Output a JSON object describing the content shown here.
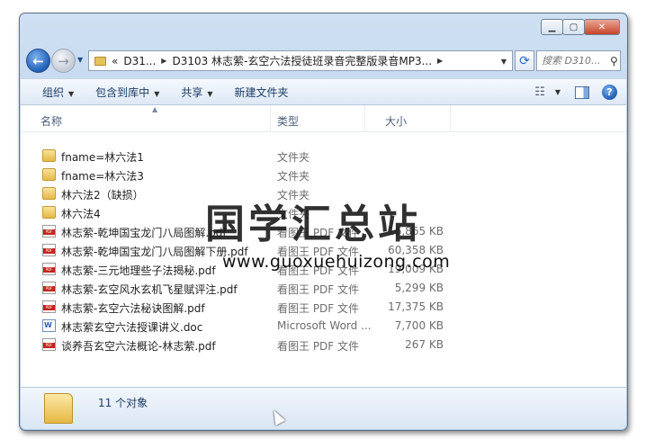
{
  "address": {
    "prefix": "«",
    "part1": "D31...",
    "part2": "D3103 林志萦-玄空六法授徒班录音完整版录音MP3..."
  },
  "search": {
    "placeholder": "搜索 D310..."
  },
  "toolbar": {
    "organize": "组织",
    "include_library": "包含到库中",
    "share": "共享",
    "new_folder": "新建文件夹"
  },
  "columns": {
    "name": "名称",
    "type": "类型",
    "size": "大小"
  },
  "files": [
    {
      "name": "fname=林六法1",
      "type": "文件夹",
      "size": "",
      "icon": "folder-icon"
    },
    {
      "name": "fname=林六法3",
      "type": "文件夹",
      "size": "",
      "icon": "folder-icon"
    },
    {
      "name": "林六法2（缺损）",
      "type": "文件夹",
      "size": "",
      "icon": "folder-icon"
    },
    {
      "name": "林六法4",
      "type": "文件夹",
      "size": "",
      "icon": "folder-icon"
    },
    {
      "name": "林志萦-乾坤国宝龙门八局图解.pdf",
      "type": "看图王 PDF 文件",
      "size": "16,865 KB",
      "icon": "pdf-file-icon"
    },
    {
      "name": "林志萦-乾坤国宝龙门八局图解下册.pdf",
      "type": "看图王 PDF 文件",
      "size": "60,358 KB",
      "icon": "pdf-file-icon"
    },
    {
      "name": "林志萦-三元地理些子法揭秘.pdf",
      "type": "看图王 PDF 文件",
      "size": "19,009 KB",
      "icon": "pdf-file-icon"
    },
    {
      "name": "林志萦-玄空风水玄机飞星赋评注.pdf",
      "type": "看图王 PDF 文件",
      "size": "5,299 KB",
      "icon": "pdf-file-icon"
    },
    {
      "name": "林志萦-玄空六法秘诀图解.pdf",
      "type": "看图王 PDF 文件",
      "size": "17,375 KB",
      "icon": "pdf-file-icon"
    },
    {
      "name": "林志萦玄空六法授课讲义.doc",
      "type": "Microsoft Word ...",
      "size": "7,700 KB",
      "icon": "word-doc-icon"
    },
    {
      "name": "谈养吾玄空六法概论-林志萦.pdf",
      "type": "看图王 PDF 文件",
      "size": "267 KB",
      "icon": "pdf-file-icon"
    }
  ],
  "status": {
    "count": "11 个对象"
  },
  "watermark": {
    "text": "国学汇总站",
    "url": "www.guoxuehuizong.com"
  }
}
